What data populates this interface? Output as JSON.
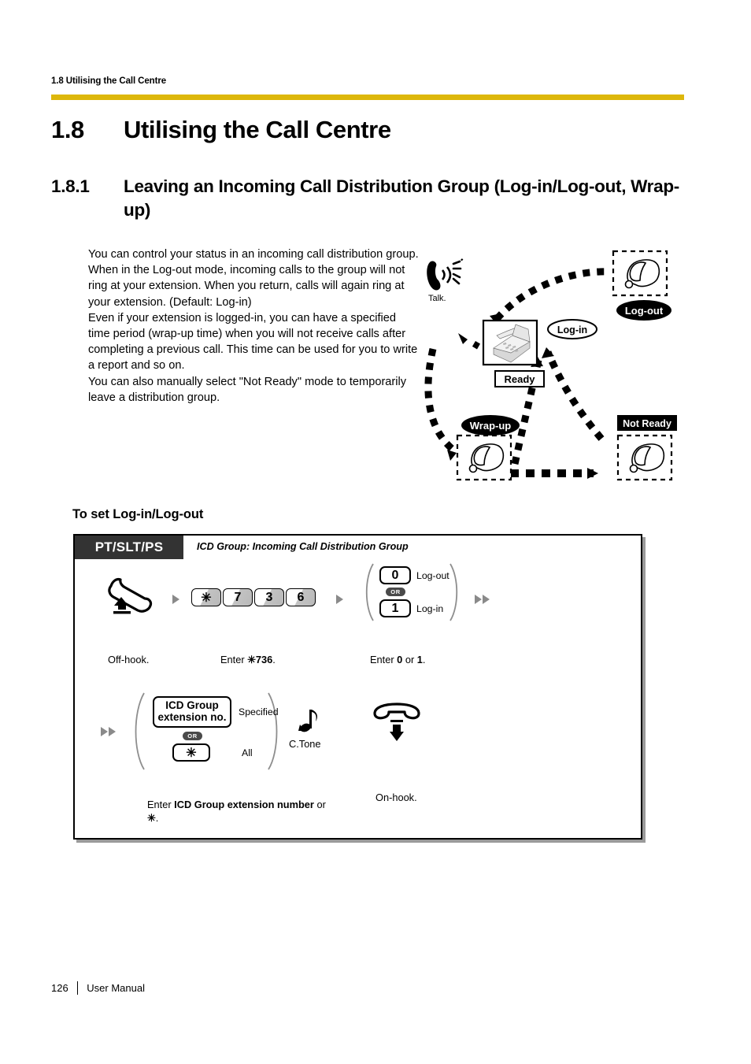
{
  "running_head": "1.8 Utilising the Call Centre",
  "accent_color": "#ddb70b",
  "headings": {
    "section_number": "1.8",
    "section_title": "Utilising the Call Centre",
    "subsection_number": "1.8.1",
    "subsection_title": "Leaving an Incoming Call Distribution Group (Log-in/Log-out, Wrap-up)"
  },
  "intro": {
    "p1": "You can control your status in an incoming call distribution group. When in the Log-out mode, incoming calls to the group will not ring at your extension. When you return, calls will again ring at your extension. (Default: Log-in)",
    "p2": "Even if your extension is logged-in, you can have a specified time period (wrap-up time) when you will not receive calls after completing a previous call. This time can be used for you to write a report and so on.",
    "p3": "You can also manually select \"Not Ready\" mode to temporarily leave a distribution group."
  },
  "state_diagram": {
    "states": [
      {
        "id": "ready",
        "label": "Ready"
      },
      {
        "id": "log-out",
        "label": "Log-out"
      },
      {
        "id": "log-in",
        "label": "Log-in"
      },
      {
        "id": "wrap-up",
        "label": "Wrap-up"
      },
      {
        "id": "not-ready",
        "label": "Not Ready"
      }
    ],
    "talk_label": "Talk."
  },
  "procedure": {
    "subhead": "To set Log-in/Log-out",
    "device_tag": "PT/SLT/PS",
    "legend": "ICD Group: Incoming Call Distribution Group",
    "row1": {
      "offhook_caption": "Off-hook.",
      "feature_keys": [
        "✳",
        "7",
        "3",
        "6"
      ],
      "enter_code_caption_pre": "Enter ",
      "enter_code_caption_code": "✳736",
      "enter_code_caption_post": ".",
      "choice": {
        "option_a_key": "0",
        "option_a_label": "Log-out",
        "or_label": "OR",
        "option_b_key": "1",
        "option_b_label": "Log-in"
      },
      "choice_caption_pre": "Enter ",
      "choice_caption_a": "0",
      "choice_caption_mid": " or ",
      "choice_caption_b": "1",
      "choice_caption_post": "."
    },
    "row2": {
      "choice": {
        "option_a_key_line1": "ICD Group",
        "option_a_key_line2": "extension no.",
        "option_a_label": "Specified",
        "or_label": "OR",
        "option_b_key": "✳",
        "option_b_label": "All"
      },
      "caption_pre": "Enter ",
      "caption_bold1": "ICD Group extension number",
      "caption_mid": " or ",
      "caption_star": "✳",
      "caption_post": ".",
      "tone_label": "C.Tone",
      "onhook_caption": "On-hook."
    }
  },
  "footer": {
    "page_number": "126",
    "doc_title": "User Manual"
  }
}
